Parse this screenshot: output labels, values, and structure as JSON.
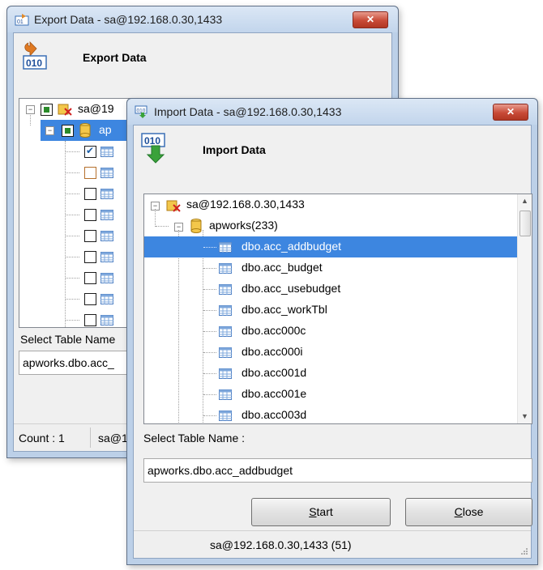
{
  "export_window": {
    "title": "Export Data - sa@192.168.0.30,1433",
    "close_glyph": "✕",
    "header_title": "Export Data",
    "server_label": "sa@19",
    "db_label": "ap",
    "select_label": "Select Table Name",
    "select_value": "apworks.dbo.acc_",
    "status_count": "Count : 1",
    "status_server": "sa@1"
  },
  "import_window": {
    "title": "Import Data - sa@192.168.0.30,1433",
    "close_glyph": "✕",
    "header_title": "Import Data",
    "tree": {
      "server": "sa@192.168.0.30,1433",
      "database": "apworks(233)",
      "tables": [
        "dbo.acc_addbudget",
        "dbo.acc_budget",
        "dbo.acc_usebudget",
        "dbo.acc_workTbl",
        "dbo.acc000c",
        "dbo.acc000i",
        "dbo.acc001d",
        "dbo.acc001e",
        "dbo.acc003d"
      ],
      "selected_index": 0
    },
    "select_label": "Select Table Name :",
    "select_value": "apworks.dbo.acc_addbudget",
    "start_prefix": "",
    "start_accel": "S",
    "start_rest": "tart",
    "close_prefix": "",
    "close_accel": "C",
    "close_rest": "lose",
    "status_text": "sa@192.168.0.30,1433 (51)"
  },
  "colors": {
    "selection": "#3d86e0",
    "close_button": "#c84a37"
  }
}
